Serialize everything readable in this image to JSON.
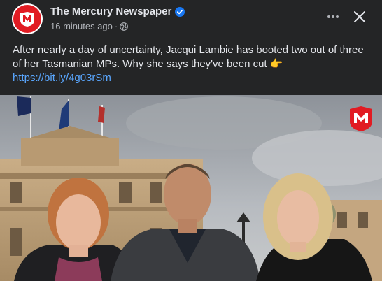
{
  "post": {
    "author": "The Mercury Newspaper",
    "timestamp": "16 minutes ago",
    "separator": "·",
    "text": "After nearly a day of uncertainty, Jacqui Lambie has booted two out of three of her Tasmanian MPs. Why she says they've been cut",
    "emoji": "👉",
    "link": "https://bit.ly/4g03rSm",
    "more_label": "···",
    "close_label": "✕"
  },
  "colors": {
    "background": "#242526",
    "text": "#e4e6eb",
    "secondary": "#b0b3b8",
    "link": "#5aa7ff",
    "brand": "#e11b22",
    "verified": "#1877f2"
  },
  "icons": {
    "avatar": "mercury-logo-icon",
    "verified": "verified-badge-icon",
    "privacy": "globe-icon",
    "more": "more-options-icon",
    "close": "close-icon",
    "watermark": "mercury-watermark-icon"
  }
}
